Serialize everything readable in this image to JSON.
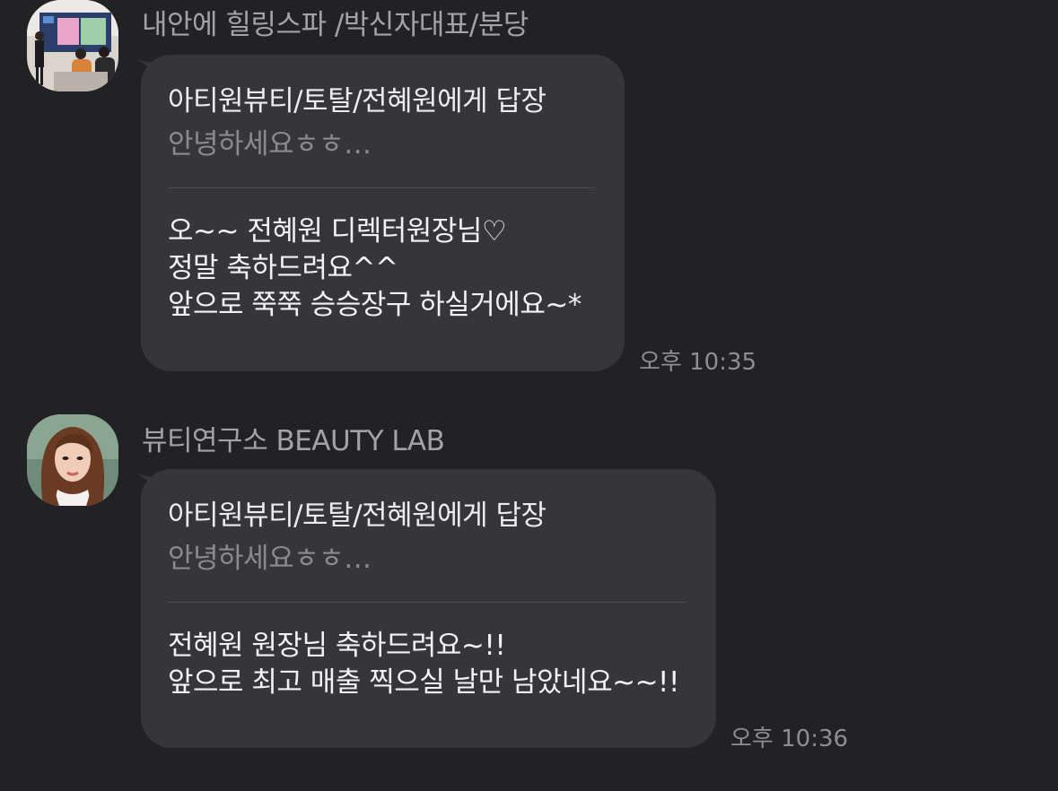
{
  "messages": [
    {
      "sender": "내안에 힐링스파 /박신자대표/분당",
      "avatar_icon": "presentation-photo-avatar",
      "reply_title": "아티원뷰티/토탈/전혜원에게 답장",
      "reply_preview": "안녕하세요ㅎㅎ…",
      "lines": [
        "오~~ 전혜원 디렉터원장님♡",
        "정말 축하드려요^^",
        "앞으로 쭉쭉 승승장구 하실거에요~*"
      ],
      "time": "오후 10:35"
    },
    {
      "sender": "뷰티연구소 BEAUTY LAB",
      "avatar_icon": "woman-portrait-avatar",
      "reply_title": "아티원뷰티/토탈/전혜원에게 답장",
      "reply_preview": "안녕하세요ㅎㅎ…",
      "lines": [
        "전혜원 원장님 축하드려요~!!",
        "앞으로 최고 매출 찍으실 날만 남았네요~~!!"
      ],
      "time": "오후 10:36"
    }
  ],
  "colors": {
    "background": "#222224",
    "bubble": "#363638",
    "sender_text": "#a3a3a6",
    "preview_text": "#8b8b8e",
    "time_text": "#8e8e91"
  }
}
